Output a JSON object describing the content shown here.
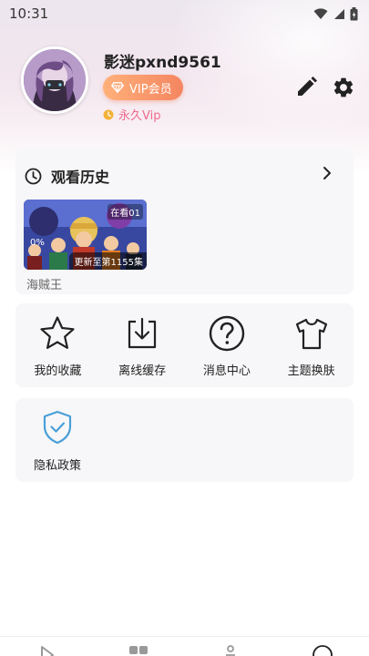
{
  "status_bar": {
    "time": "10:31",
    "icons": [
      "wifi-icon",
      "signal-icon",
      "battery-icon"
    ]
  },
  "profile": {
    "username": "影迷pxnd9561",
    "vip_badge_label": "VIP会员",
    "vip_status": "永久Vip"
  },
  "history": {
    "title": "观看历史",
    "items": [
      {
        "title": "海贼王",
        "episode": "在看01",
        "progress": "0%",
        "update": "更新至第1155集"
      }
    ]
  },
  "functions": [
    {
      "label": "我的收藏",
      "icon": "star-icon"
    },
    {
      "label": "离线缓存",
      "icon": "download-icon"
    },
    {
      "label": "消息中心",
      "icon": "question-icon"
    },
    {
      "label": "主题换肤",
      "icon": "tshirt-icon"
    }
  ],
  "privacy": {
    "label": "隐私政策",
    "icon": "shield-check-icon"
  },
  "bottom_nav": {
    "icons": [
      "play-icon",
      "grid-icon",
      "rank-icon",
      "profile-icon"
    ]
  },
  "colors": {
    "accent_vip": "#f48560",
    "vip_text": "#f06a8e",
    "shield": "#4a9fd8",
    "card_bg": "#f7f7f9"
  }
}
